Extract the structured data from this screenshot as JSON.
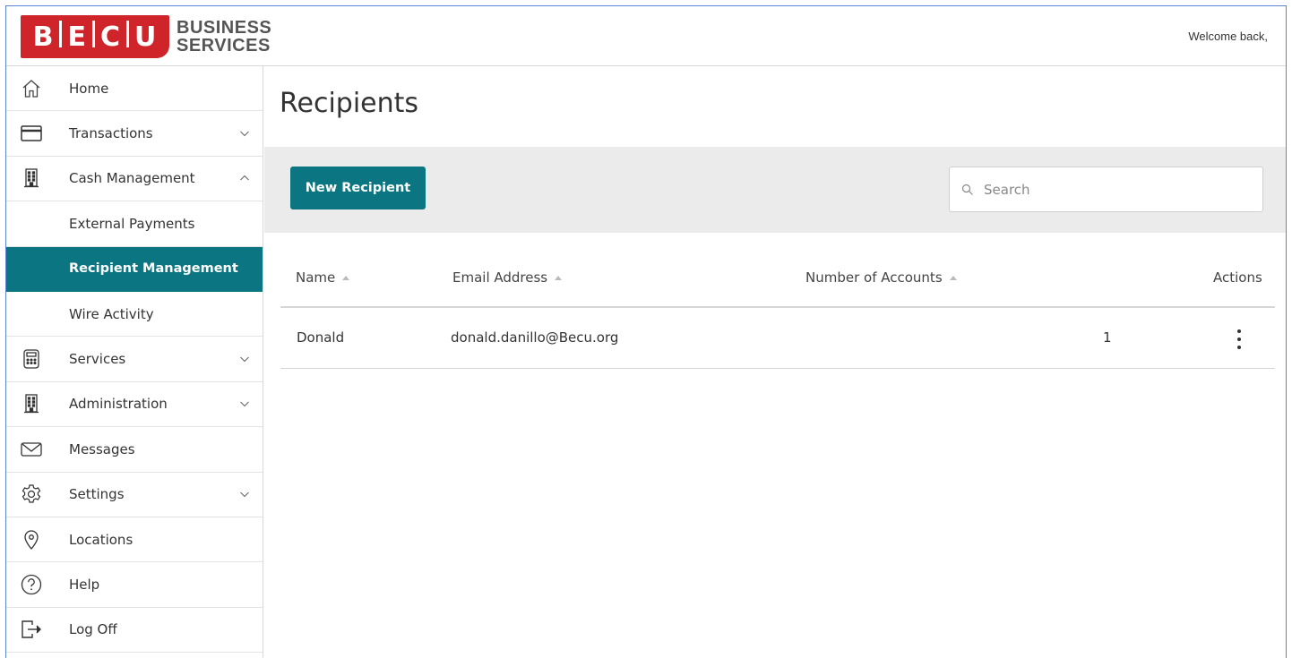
{
  "header": {
    "logo_letters": [
      "B",
      "E",
      "C",
      "U"
    ],
    "logo_line1": "BUSINESS",
    "logo_line2": "SERVICES",
    "welcome": "Welcome back,"
  },
  "sidebar": {
    "items": [
      {
        "label": "Home",
        "icon": "home-icon"
      },
      {
        "label": "Transactions",
        "icon": "card-icon",
        "chevron": "down"
      },
      {
        "label": "Cash Management",
        "icon": "building-icon",
        "chevron": "up"
      },
      {
        "label": "External Payments"
      },
      {
        "label": "Recipient Management",
        "active": true
      },
      {
        "label": "Wire Activity"
      },
      {
        "label": "Services",
        "icon": "calculator-icon",
        "chevron": "down"
      },
      {
        "label": "Administration",
        "icon": "building-icon",
        "chevron": "down"
      },
      {
        "label": "Messages",
        "icon": "envelope-icon"
      },
      {
        "label": "Settings",
        "icon": "gear-icon",
        "chevron": "down"
      },
      {
        "label": "Locations",
        "icon": "location-pin-icon"
      },
      {
        "label": "Help",
        "icon": "question-icon"
      },
      {
        "label": "Log Off",
        "icon": "logout-icon"
      }
    ]
  },
  "main": {
    "title": "Recipients",
    "new_button": "New Recipient",
    "search_placeholder": "Search",
    "columns": {
      "name": "Name",
      "email": "Email Address",
      "accounts": "Number of Accounts",
      "actions": "Actions"
    },
    "rows": [
      {
        "name": "Donald",
        "email": "donald.danillo@Becu.org",
        "accounts": "1"
      }
    ]
  },
  "colors": {
    "brand_red": "#d0242b",
    "accent_teal": "#0b7681",
    "toolbar_gray": "#ebebeb"
  }
}
